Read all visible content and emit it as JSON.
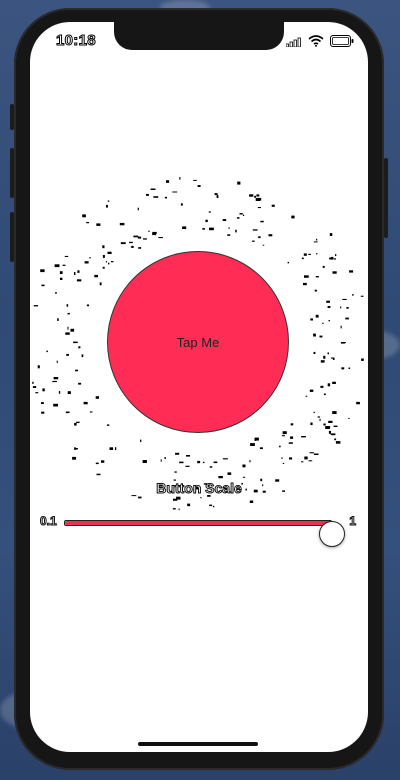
{
  "status_bar": {
    "time": "10:18",
    "icons": [
      "cellular-signal-icon",
      "wifi-icon",
      "battery-icon"
    ]
  },
  "tap_button": {
    "label": "Tap Me",
    "color": "#ff2d55"
  },
  "slider": {
    "caption": "Button Scale",
    "min_label": "0.1",
    "max_label": "1",
    "value_fraction": 1.0,
    "accent_color": "#e8324f"
  }
}
